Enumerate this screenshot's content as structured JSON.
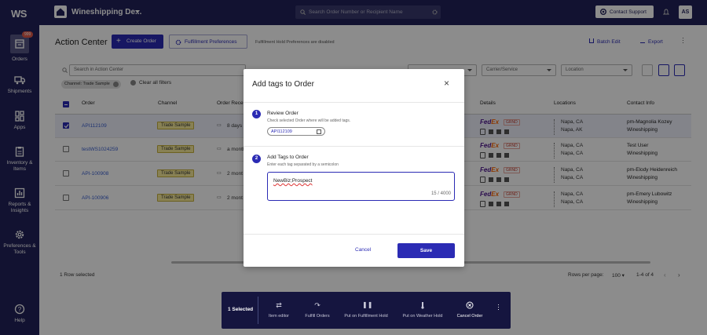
{
  "sidebar": {
    "logo": "WS",
    "badge": "999",
    "items": [
      {
        "label": "Orders",
        "icon": "box-icon"
      },
      {
        "label": "Shipments",
        "icon": "truck-icon"
      },
      {
        "label": "Apps",
        "icon": "apps-icon"
      },
      {
        "label": "Inventory & Items",
        "icon": "clipboard-icon"
      },
      {
        "label": "Reports & Insights",
        "icon": "chart-icon"
      },
      {
        "label": "Preferences & Tools",
        "icon": "gear-icon"
      }
    ],
    "help": "Help"
  },
  "topbar": {
    "workspace": "Wineshipping De...",
    "search_placeholder": "Search Order Number or Recipient Name",
    "contact_support": "Contact Support",
    "avatar": "AS"
  },
  "page": {
    "title": "Action Center",
    "create_order": "Create Order",
    "fulfillment_prefs": "Fulfillment Preferences",
    "hold_notice": "Fulfillment Hold Preferences are disabled",
    "batch_edit": "Batch Edit",
    "export": "Export",
    "search_placeholder": "Search in Action Center",
    "filters": {
      "carrier": "Carrier/Service",
      "location": "Location"
    },
    "chip": "Channel: Trade Sample",
    "clear_filters": "Clear all filters"
  },
  "table": {
    "headers": {
      "order": "Order",
      "channel": "Channel",
      "received": "Order Recei",
      "details": "Details",
      "locations": "Locations",
      "contact": "Contact Info"
    },
    "rows": [
      {
        "order": "API112109",
        "channel": "Trade Sample",
        "received": "8 days",
        "grnd": "GRND",
        "loc1": "Napa, CA",
        "loc2": "Napa, AK",
        "contact": "pm-Magnolia Kozey",
        "company": "Wineshipping",
        "checked": true
      },
      {
        "order": "testWS1024259",
        "channel": "Trade Sample",
        "received": "a month",
        "grnd": "GRND",
        "loc1": "Napa, CA",
        "loc2": "Napa, CA",
        "contact": "Test User",
        "company": "Wineshipping",
        "checked": false
      },
      {
        "order": "API-100908",
        "channel": "Trade Sample",
        "received": "2 mont",
        "grnd": "GRND",
        "loc1": "Napa, CA",
        "loc2": "Napa, CA",
        "contact": "pm-Elody Heidenreich",
        "company": "Wineshipping",
        "checked": false
      },
      {
        "order": "API-100906",
        "channel": "Trade Sample",
        "received": "2 mont",
        "grnd": "GRND",
        "loc1": "Napa, CA",
        "loc2": "Napa, CA",
        "contact": "pm-Emery Lubowitz",
        "company": "Wineshipping",
        "checked": false
      }
    ],
    "fedex_a": "Fed",
    "fedex_b": "Ex",
    "selected_count": "1 Row selected",
    "rows_per_page_label": "Rows per page:",
    "rows_per_page": "100",
    "range": "1-4 of 4"
  },
  "modal": {
    "title": "Add tags to Order",
    "step1": {
      "num": "1",
      "title": "Review Order",
      "subtitle": "Check selected Order where will be added tags.",
      "chip": "API112109"
    },
    "step2": {
      "num": "2",
      "title": "Add Tags to Order",
      "subtitle": "Enter each tag separated by a semicolon",
      "value": "NewBiz;Prospect",
      "counter": "15 / 4000"
    },
    "cancel": "Cancel",
    "save": "Save"
  },
  "actionbar": {
    "selected": "1 Selected",
    "items": [
      "Item editor",
      "Fulfill Orders",
      "Put on Fulfillment Hold",
      "Put on Weather Hold",
      "Cancel Order"
    ]
  },
  "colors": {
    "brand": "#22225a",
    "accent": "#2b2bb4"
  }
}
